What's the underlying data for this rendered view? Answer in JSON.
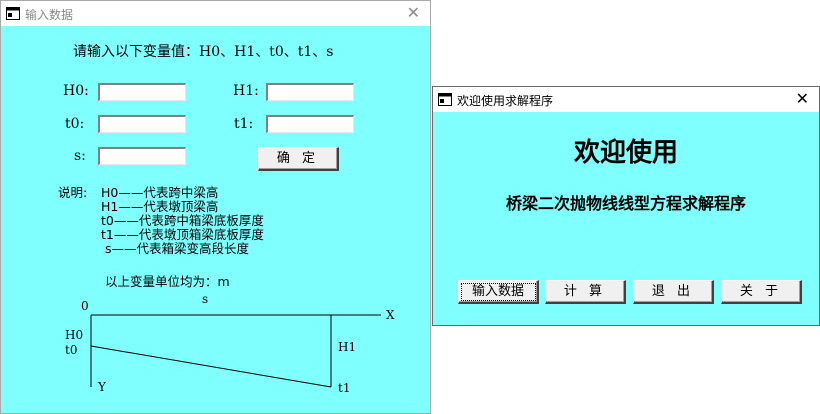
{
  "input_window": {
    "title": "输入数据",
    "prompt": "请输入以下变量值：H0、H1、t0、t1、s",
    "fields": [
      {
        "label": "H0:",
        "value": ""
      },
      {
        "label": "H1:",
        "value": ""
      },
      {
        "label": "t0:",
        "value": ""
      },
      {
        "label": "t1:",
        "value": ""
      },
      {
        "label": "s:",
        "value": ""
      }
    ],
    "confirm_button": "确 定",
    "explain_prefix": "说明:",
    "explain_lines": [
      "H0——代表跨中梁高",
      "H1——代表墩顶梁高",
      "t0——代表跨中箱梁底板厚度",
      "t1——代表墩顶箱梁底板厚度",
      " s——代表箱梁变高段长度"
    ],
    "unit_note": "以上变量单位均为：m",
    "diagram": {
      "origin": "0",
      "s": "s",
      "x": "X",
      "y": "Y",
      "h0": "H0",
      "t0": "t0",
      "h1": "H1",
      "t1": "t1"
    }
  },
  "welcome_window": {
    "title": "欢迎使用求解程序",
    "heading": "欢迎使用",
    "subtitle": "桥梁二次抛物线线型方程求解程序",
    "buttons": {
      "input": "输入数据",
      "compute": "计 算",
      "exit": "退 出",
      "about": "关 于"
    }
  },
  "colors": {
    "client_bg": "#80ffff",
    "title_bg": "#ffffff"
  },
  "icons": {
    "window_icon": "app-window-icon",
    "close": "close-icon"
  }
}
